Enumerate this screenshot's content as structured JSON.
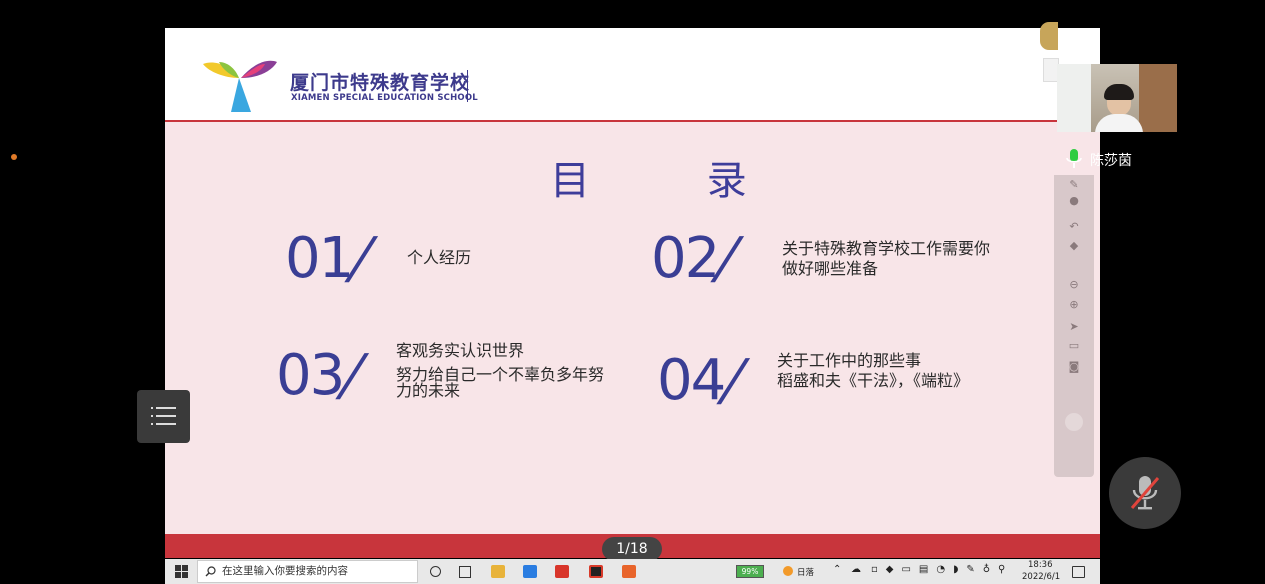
{
  "slide": {
    "logo": {
      "title": "厦门市特殊教育学校",
      "subtitle": "XIAMEN SPECIAL EDUCATION SCHOOL"
    },
    "toc_title": "目 录",
    "items": [
      {
        "num": "01",
        "lines": [
          "个人经历"
        ]
      },
      {
        "num": "02",
        "lines": [
          "关于特殊教育学校工作需要你",
          "做好哪些准备"
        ]
      },
      {
        "num": "03",
        "lines": [
          "客观务实认识世界",
          "努力给自己一个不辜负多年努",
          "力的未来"
        ]
      },
      {
        "num": "04",
        "lines": [
          "关于工作中的那些事",
          "稻盛和夫《干法》，《端粒》"
        ]
      }
    ]
  },
  "page_indicator": "1/18",
  "participant": {
    "name": "陈莎茵"
  },
  "taskbar": {
    "search_placeholder": "在这里输入你要搜索的内容",
    "battery": "99%",
    "weather": "日落",
    "time": "18:36",
    "date": "2022/6/1"
  },
  "colors": {
    "slide_bg": "#f8e5e8",
    "accent_red": "#c8353c",
    "brand_purple": "#3d3a8c"
  }
}
